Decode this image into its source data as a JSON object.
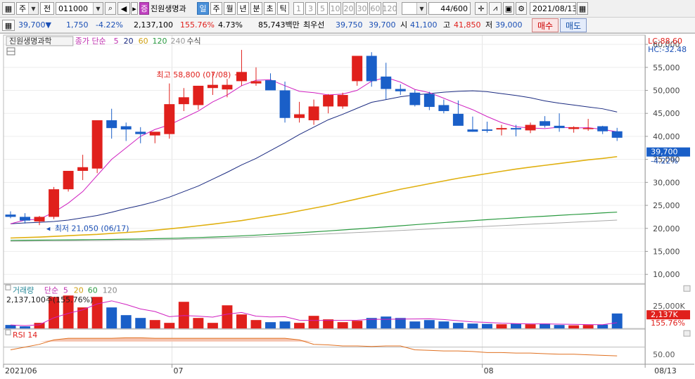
{
  "toolbar": {
    "type_select": "주",
    "chart_mode": "전",
    "code": "011000",
    "stock_badge": "증",
    "stock_name": "진원생명과",
    "periods": [
      "일",
      "주",
      "월",
      "년",
      "분",
      "초",
      "틱"
    ],
    "selected_period": "일",
    "intervals": [
      "1",
      "3",
      "5",
      "10",
      "20",
      "30",
      "60",
      "120"
    ],
    "count": "44/600",
    "date": "2021/08/13"
  },
  "quote": {
    "price": "39,700",
    "arrow": "▼",
    "change": "1,750",
    "change_pct": "-4.22%",
    "volume": "2,137,100",
    "vol_ratio": "155.76%",
    "turnover": "4.73%",
    "amount": "85,743백만",
    "best_ask_label": "최우선",
    "best_ask": "39,750",
    "best_bid": "39,700",
    "open_label": "시",
    "open": "41,100",
    "high_label": "고",
    "high": "41,850",
    "low_label": "저",
    "low": "39,000",
    "buy_label": "매수",
    "sell_label": "매도"
  },
  "price_panel": {
    "name": "진원생명과학",
    "ma_label": "종가 단순",
    "ma_periods": [
      "5",
      "20",
      "60",
      "120",
      "240"
    ],
    "formula": "수식",
    "lc": "LC:88.60",
    "hc": "HC:-32.48",
    "current_price": "39,700",
    "current_pct": "-4.22%",
    "high_marker": "최고 58,800 (07/08)",
    "low_marker": "최저 21,050 (06/17)"
  },
  "volume_panel": {
    "label": "거래량",
    "ma_label": "단순",
    "ma_periods": [
      "5",
      "20",
      "60",
      "120"
    ],
    "info": "2,137,100주(155.76%)",
    "current": "2,137K",
    "current_pct": "155.76%"
  },
  "rsi_panel": {
    "label": "RSI 14",
    "tick": "50.00"
  },
  "x_axis": {
    "labels": [
      "2021/06",
      "07",
      "08"
    ],
    "last_date": "08/13"
  },
  "colors": {
    "up": "#e0201c",
    "down": "#1a5fc8",
    "ma5": "#d020c0",
    "ma20": "#1a2a80",
    "ma60": "#e0b010",
    "ma120": "#2a9a40",
    "ma240": "#aaaaaa"
  },
  "chart_data": {
    "type": "candlestick",
    "x": [
      "06/16",
      "06/17",
      "06/18",
      "06/21",
      "06/22",
      "06/23",
      "06/24",
      "06/25",
      "06/28",
      "06/29",
      "06/30",
      "07/01",
      "07/02",
      "07/05",
      "07/06",
      "07/07",
      "07/08",
      "07/09",
      "07/12",
      "07/13",
      "07/14",
      "07/15",
      "07/16",
      "07/19",
      "07/20",
      "07/21",
      "07/22",
      "07/23",
      "07/26",
      "07/27",
      "07/28",
      "07/29",
      "07/30",
      "08/02",
      "08/03",
      "08/04",
      "08/05",
      "08/06",
      "08/09",
      "08/10",
      "08/11",
      "08/12",
      "08/13"
    ],
    "open": [
      23000,
      22500,
      21500,
      22500,
      28500,
      32500,
      33000,
      43500,
      42200,
      41000,
      40200,
      40500,
      47000,
      46800,
      50500,
      50200,
      52000,
      51500,
      52200,
      50000,
      44000,
      43500,
      46500,
      46500,
      52000,
      57500,
      53000,
      50300,
      49500,
      49200,
      46800,
      44900,
      41500,
      41500,
      41500,
      41800,
      41300,
      43300,
      42300,
      41600,
      41600,
      42200,
      41100
    ],
    "high": [
      23700,
      23300,
      22700,
      29000,
      32500,
      36000,
      35000,
      46000,
      43000,
      42000,
      40500,
      51500,
      50500,
      51000,
      54000,
      52500,
      58800,
      55000,
      53700,
      51900,
      47500,
      48000,
      49200,
      49500,
      56000,
      58300,
      56000,
      51300,
      50100,
      49700,
      48000,
      47800,
      44300,
      43200,
      42500,
      42500,
      43000,
      44400,
      45000,
      42200,
      43800,
      42300,
      41850
    ],
    "low": [
      22200,
      21050,
      20700,
      22000,
      28000,
      30500,
      32000,
      39500,
      39000,
      38500,
      38500,
      39500,
      45500,
      45800,
      49000,
      48500,
      51000,
      51000,
      50000,
      43000,
      43000,
      42500,
      45000,
      46000,
      51000,
      50800,
      48000,
      49000,
      46500,
      45700,
      45000,
      43500,
      41000,
      40800,
      40200,
      40000,
      40700,
      41900,
      41000,
      40800,
      41200,
      40500,
      39000
    ],
    "close": [
      22500,
      21700,
      22500,
      28500,
      32500,
      33300,
      43500,
      41800,
      41500,
      40500,
      41000,
      47000,
      48500,
      51000,
      51200,
      51200,
      54000,
      52000,
      50000,
      44000,
      44800,
      46500,
      49000,
      49000,
      57500,
      52000,
      50300,
      49800,
      46800,
      46400,
      45500,
      42300,
      41000,
      41200,
      41800,
      41500,
      42500,
      42300,
      41800,
      42000,
      41800,
      41100,
      39700
    ],
    "ma5": [
      21000,
      21800,
      22000,
      23500,
      25500,
      28000,
      31500,
      35000,
      37500,
      40000,
      41500,
      42500,
      44000,
      45500,
      47500,
      49000,
      51000,
      52200,
      52300,
      51000,
      49800,
      49500,
      49000,
      49200,
      50000,
      52000,
      52800,
      51800,
      50200,
      49500,
      48300,
      47000,
      45800,
      44300,
      43000,
      42100,
      41800,
      41700,
      42000,
      41800,
      41900,
      41500,
      41000
    ],
    "ma20": [
      21000,
      21200,
      21300,
      21500,
      21800,
      22300,
      22800,
      23500,
      24300,
      25000,
      25800,
      26800,
      28000,
      29200,
      30700,
      32200,
      33800,
      35200,
      36900,
      38600,
      40400,
      42000,
      43600,
      44800,
      46100,
      47400,
      48000,
      48600,
      49000,
      49300,
      49600,
      49800,
      49900,
      49700,
      49300,
      48900,
      48400,
      47700,
      47200,
      46800,
      46400,
      46000,
      45300
    ],
    "ma60": [
      17900,
      18000,
      18100,
      18250,
      18400,
      18550,
      18700,
      18900,
      19100,
      19300,
      19600,
      19900,
      20200,
      20550,
      20900,
      21300,
      21700,
      22200,
      22700,
      23200,
      23800,
      24400,
      25000,
      25700,
      26400,
      27100,
      27800,
      28500,
      29100,
      29700,
      30300,
      30900,
      31400,
      31900,
      32400,
      32900,
      33300,
      33700,
      34100,
      34500,
      34900,
      35200,
      35600
    ],
    "ma120": [
      17400,
      17420,
      17450,
      17470,
      17500,
      17530,
      17560,
      17600,
      17650,
      17700,
      17760,
      17820,
      17900,
      18000,
      18110,
      18230,
      18370,
      18520,
      18690,
      18860,
      19050,
      19240,
      19440,
      19650,
      19870,
      20100,
      20330,
      20560,
      20800,
      21030,
      21250,
      21470,
      21680,
      21890,
      22090,
      22280,
      22470,
      22650,
      22830,
      23010,
      23180,
      23360,
      23530
    ],
    "ma240": [
      17200,
      17220,
      17240,
      17260,
      17280,
      17300,
      17330,
      17360,
      17400,
      17450,
      17510,
      17570,
      17640,
      17720,
      17810,
      17910,
      18020,
      18130,
      18250,
      18380,
      18520,
      18660,
      18800,
      18950,
      19100,
      19250,
      19400,
      19550,
      19700,
      19850,
      20000,
      20150,
      20300,
      20450,
      20600,
      20750,
      20900,
      21050,
      21200,
      21350,
      21500,
      21650,
      21800
    ],
    "volume": [
      500,
      300,
      800,
      4500,
      4700,
      3000,
      4500,
      3000,
      1900,
      1500,
      1200,
      800,
      3800,
      1500,
      800,
      3300,
      2000,
      1200,
      900,
      1000,
      800,
      1800,
      1300,
      900,
      1100,
      1500,
      1700,
      1500,
      1000,
      1200,
      1000,
      800,
      700,
      650,
      600,
      700,
      600,
      700,
      500,
      450,
      500,
      550,
      2137
    ],
    "rsi": [
      45,
      50,
      55,
      63,
      66,
      66,
      66,
      66,
      67,
      67,
      66,
      66,
      66,
      66,
      66,
      66,
      66,
      66,
      66,
      66,
      63,
      55,
      54,
      52,
      52,
      51,
      52,
      52,
      45,
      44,
      43,
      43,
      42,
      40,
      40,
      39,
      39,
      38,
      37,
      37,
      36,
      35,
      34
    ],
    "ylim": [
      8000,
      62000
    ],
    "y_ticks": [
      10000,
      15000,
      20000,
      25000,
      30000,
      35000,
      40000,
      45000,
      50000,
      55000,
      60000
    ],
    "vol_ticks": [
      "25,000K"
    ],
    "rsi_ticks": [
      50
    ]
  }
}
